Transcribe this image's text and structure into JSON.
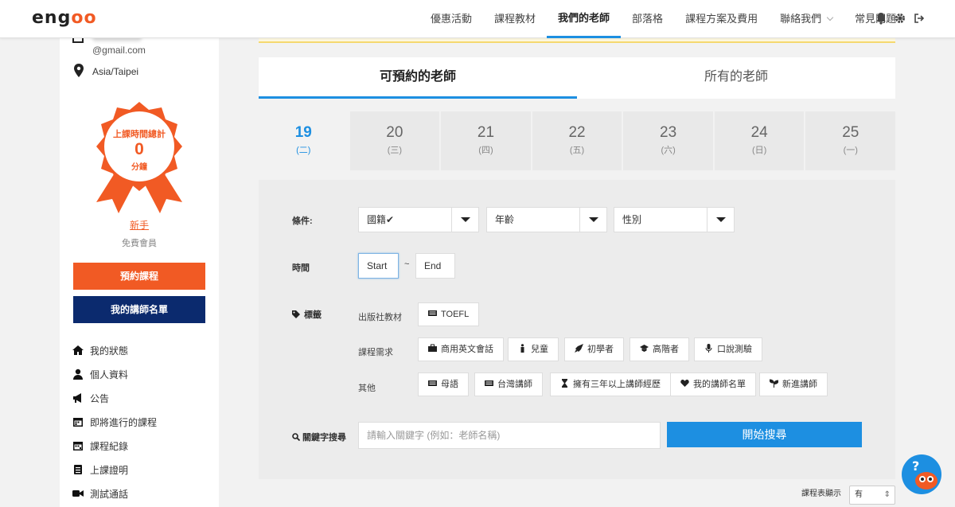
{
  "header": {
    "logo_text": "engoo",
    "nav": [
      "優惠活動",
      "課程教材",
      "我們的老師",
      "部落格",
      "課程方案及費用",
      "聯絡我們",
      "常見問題"
    ],
    "active_nav": 2
  },
  "sidebar": {
    "email": "@gmail.com",
    "timezone": "Asia/Taipei",
    "badge_title": "上課時間總計",
    "badge_value": "0",
    "badge_unit": "分鐘",
    "level": "新手",
    "membership": "免費會員",
    "book_button": "預約課程",
    "teacher_list_button": "我的講師名單",
    "menu": [
      {
        "label": "我的狀態",
        "icon": "home-icon"
      },
      {
        "label": "個人資料",
        "icon": "user-icon"
      },
      {
        "label": "公告",
        "icon": "megaphone-icon"
      },
      {
        "label": "即將進行的課程",
        "icon": "calendar-icon"
      },
      {
        "label": "課程紀錄",
        "icon": "calendar-icon"
      },
      {
        "label": "上課證明",
        "icon": "document-icon"
      },
      {
        "label": "測試通話",
        "icon": "video-icon"
      }
    ]
  },
  "tabs": [
    "可預約的老師",
    "所有的老師"
  ],
  "dates": [
    {
      "day": "19",
      "weekday": "(二)"
    },
    {
      "day": "20",
      "weekday": "(三)"
    },
    {
      "day": "21",
      "weekday": "(四)"
    },
    {
      "day": "22",
      "weekday": "(五)"
    },
    {
      "day": "23",
      "weekday": "(六)"
    },
    {
      "day": "24",
      "weekday": "(日)"
    },
    {
      "day": "25",
      "weekday": "(一)"
    }
  ],
  "filters": {
    "conditions_label": "條件:",
    "nationality": "國籍✔",
    "age": "年齡",
    "gender": "性別",
    "time_label": "時間",
    "start": "Start",
    "tilde": "~",
    "end": "End",
    "tags_label": "標籤",
    "publisher_label": "出版社教材",
    "publisher_tags": [
      "TOEFL"
    ],
    "needs_label": "課程需求",
    "needs_tags": [
      "商用英文會話",
      "兒童",
      "初學者",
      "高階者",
      "口說測驗"
    ],
    "other_label": "其他",
    "other_tags": [
      "母語",
      "台灣講師",
      "擁有三年以上講師經歷",
      "我的講師名單",
      "新進講師"
    ],
    "keyword_label": "關鍵字搜尋",
    "keyword_placeholder": "請輸入關鍵字 (例如：老師名稱)",
    "search_button": "開始搜尋"
  },
  "footer": {
    "schedule_label": "課程表顯示",
    "schedule_value": "有"
  },
  "colors": {
    "accent": "#1d8fe1",
    "brand": "#f15a24",
    "navy": "#0b2a6e"
  }
}
